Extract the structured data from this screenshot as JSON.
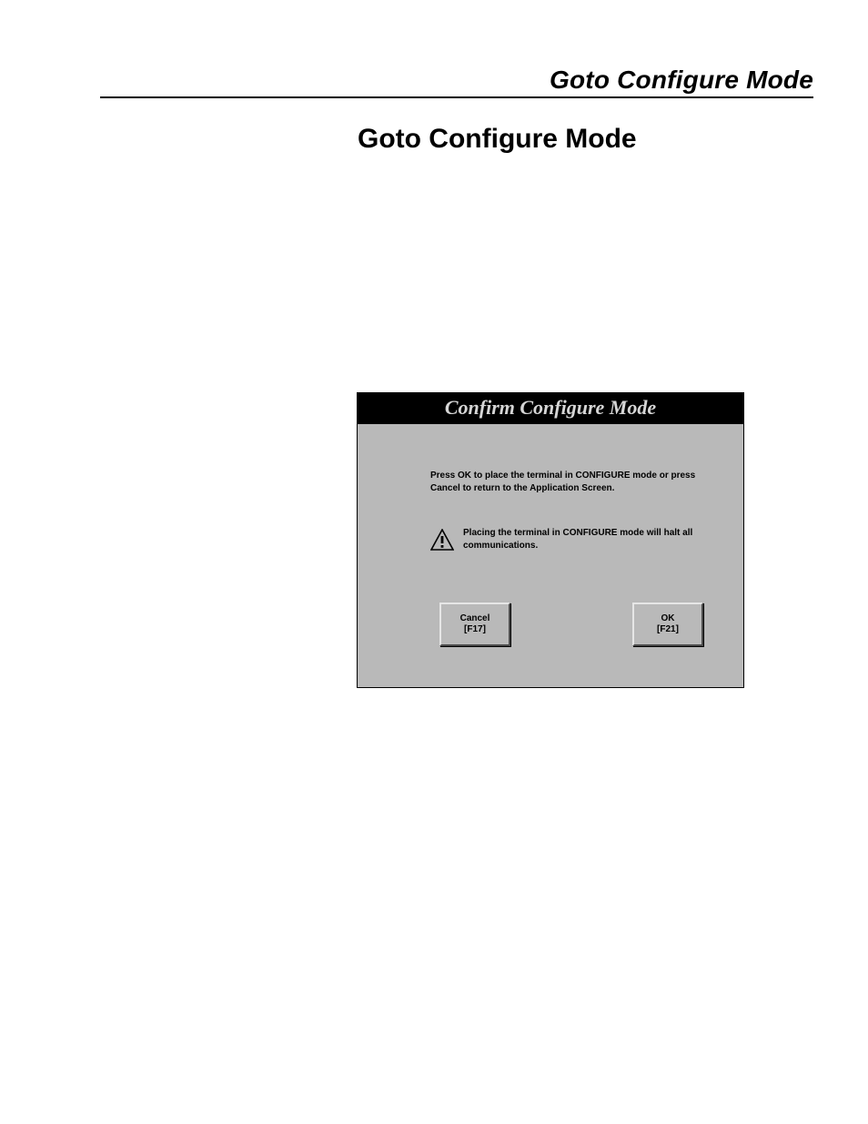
{
  "header": {
    "running_title": "Goto Configure Mode"
  },
  "section": {
    "title": "Goto Configure Mode"
  },
  "dialog": {
    "title": "Confirm Configure Mode",
    "instruction": "Press OK to place the terminal in CONFIGURE mode or press Cancel to return to the Application Screen.",
    "warning": "Placing the terminal in CONFIGURE mode will halt all communications.",
    "buttons": {
      "cancel": {
        "label": "Cancel",
        "key": "[F17]"
      },
      "ok": {
        "label": "OK",
        "key": "[F21]"
      }
    }
  }
}
